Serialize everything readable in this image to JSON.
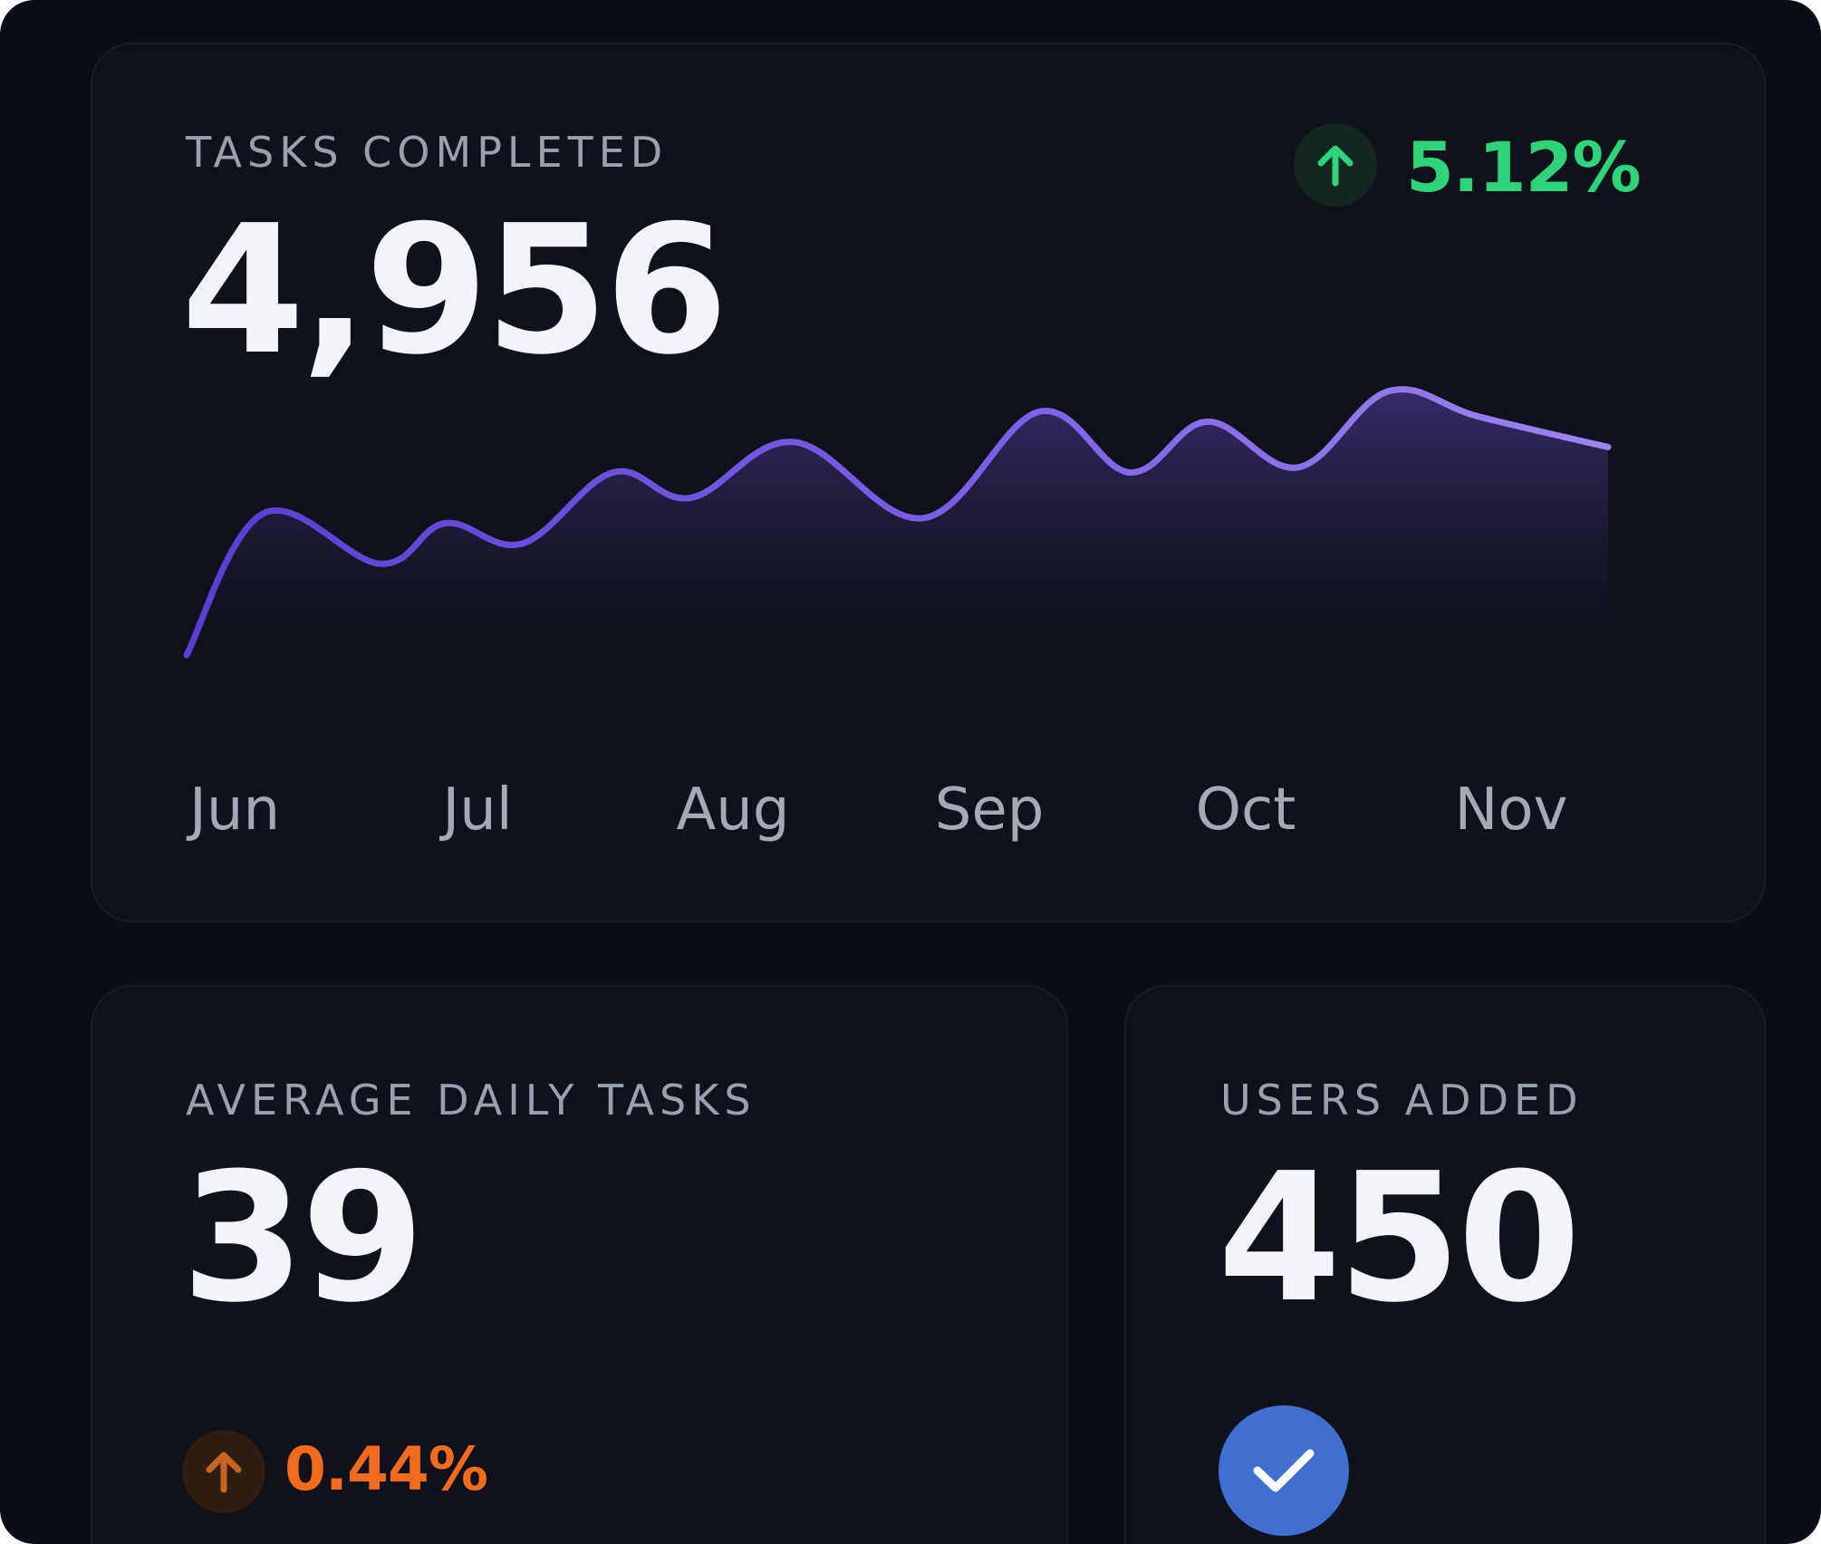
{
  "colors": {
    "background": "#0c0e15",
    "card": "#0f121a",
    "accent_purple": "#7b5ce6",
    "positive_green": "#2ed47a",
    "warning_orange": "#f26b1d",
    "check_blue": "#3f6fd1"
  },
  "tasks_card": {
    "label": "TASKS COMPLETED",
    "value": "4,956",
    "change": "5.12%",
    "change_icon": "arrow-up-icon"
  },
  "avg_card": {
    "label": "AVERAGE DAILY TASKS",
    "value": "39",
    "change": "0.44%",
    "change_icon": "arrow-up-icon"
  },
  "users_card": {
    "label": "USERS ADDED",
    "value": "450",
    "status_icon": "check-icon"
  },
  "chart_data": {
    "type": "area",
    "title": "",
    "xlabel": "",
    "ylabel": "",
    "grid": false,
    "tick_labels": [
      "Jun",
      "Jul",
      "Aug",
      "Sep",
      "Oct",
      "Nov"
    ],
    "x": [
      0,
      0.3,
      0.75,
      1.0,
      1.3,
      1.65,
      1.95,
      2.35,
      2.85,
      3.3,
      3.65,
      3.95,
      4.3,
      4.65,
      5.0,
      5.5
    ],
    "values": [
      10,
      38,
      28,
      36,
      32,
      46,
      41,
      52,
      37,
      58,
      46,
      56,
      47,
      62,
      57,
      51
    ]
  }
}
